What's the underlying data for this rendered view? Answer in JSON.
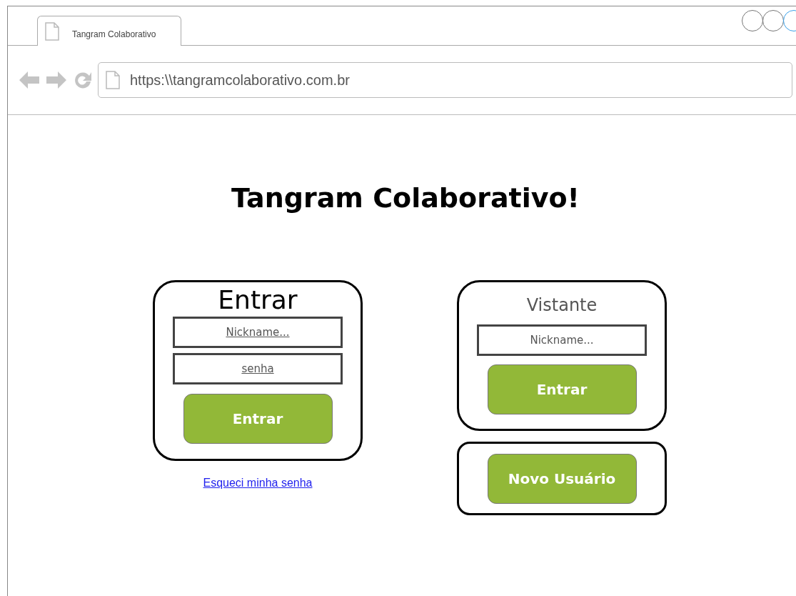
{
  "browser": {
    "tab": {
      "title": "Tangram Colaborativo",
      "selected": true
    },
    "address": "https:\\\\tangramcolaborativo.com.br"
  },
  "page": {
    "title": "Tangram Colaborativo!",
    "login": {
      "title": "Entrar",
      "fields": [
        {
          "placeholder": "Nickname...",
          "underlined": true
        },
        {
          "placeholder": "senha",
          "underlined": true
        }
      ],
      "button": "Entrar",
      "link": "Esqueci minha senha"
    },
    "visitor": {
      "title": "Vistante",
      "fields": [
        {
          "placeholder": "Nickname...",
          "underlined": false
        }
      ],
      "button": "Entrar"
    },
    "signup": {
      "button": "Novo Usuário"
    }
  }
}
